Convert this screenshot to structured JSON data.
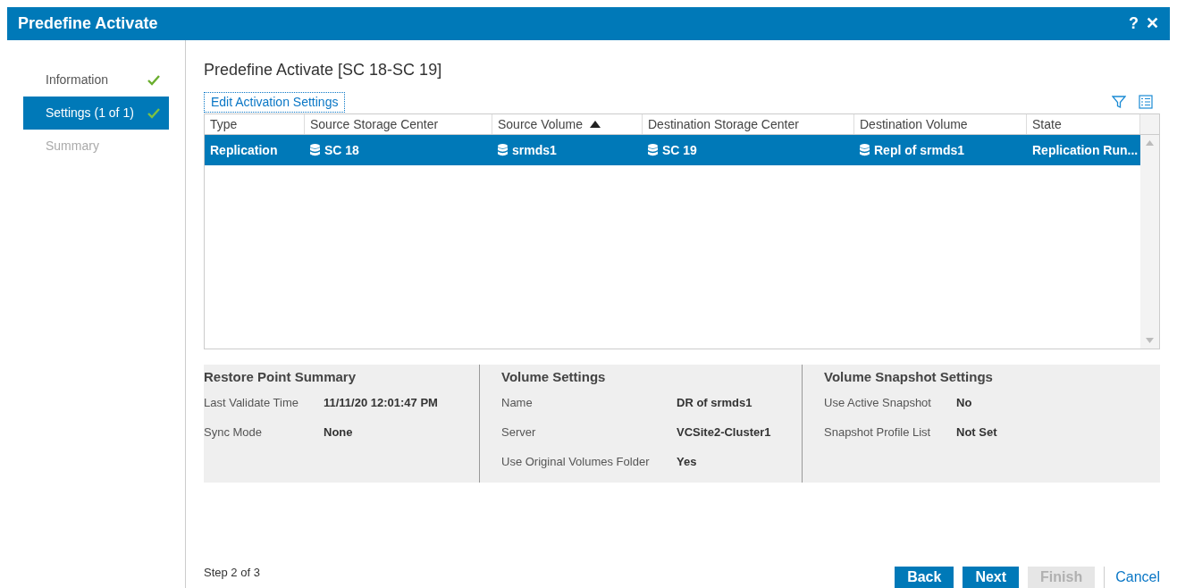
{
  "window": {
    "title": "Predefine Activate",
    "help": "?",
    "close": "✕"
  },
  "steps": [
    {
      "label": "Information",
      "done": true,
      "selected": false,
      "disabled": false
    },
    {
      "label": "Settings (1 of 1)",
      "done": true,
      "selected": true,
      "disabled": false
    },
    {
      "label": "Summary",
      "done": false,
      "selected": false,
      "disabled": true
    }
  ],
  "heading": "Predefine Activate [SC 18-SC 19]",
  "edit_link": "Edit Activation Settings",
  "table": {
    "columns": [
      {
        "label": "Type",
        "sorted": false
      },
      {
        "label": "Source Storage Center",
        "sorted": false
      },
      {
        "label": "Source Volume",
        "sorted": true
      },
      {
        "label": "Destination Storage Center",
        "sorted": false
      },
      {
        "label": "Destination Volume",
        "sorted": false
      },
      {
        "label": "State",
        "sorted": false
      }
    ],
    "rows": [
      {
        "selected": true,
        "cells": [
          {
            "text": "Replication",
            "icon": false
          },
          {
            "text": "SC 18",
            "icon": true
          },
          {
            "text": "srmds1",
            "icon": true
          },
          {
            "text": "SC 19",
            "icon": true
          },
          {
            "text": "Repl of srmds1",
            "icon": true
          },
          {
            "text": "Replication Run...",
            "icon": false
          }
        ]
      }
    ]
  },
  "sections": [
    {
      "title": "Restore Point Summary",
      "fields": [
        {
          "label": "Last Validate Time",
          "value": "11/11/20 12:01:47 PM"
        },
        {
          "label": "Sync Mode",
          "value": "None"
        }
      ]
    },
    {
      "title": "Volume Settings",
      "fields": [
        {
          "label": "Name",
          "value": "DR of srmds1"
        },
        {
          "label": "Server",
          "value": "VCSite2-Cluster1"
        },
        {
          "label": "Use Original Volumes Folder",
          "value": "Yes"
        }
      ]
    },
    {
      "title": "Volume Snapshot Settings",
      "fields": [
        {
          "label": "Use Active Snapshot",
          "value": "No"
        },
        {
          "label": "Snapshot Profile List",
          "value": "Not Set"
        }
      ]
    }
  ],
  "step_text": "Step 2 of 3",
  "buttons": [
    {
      "label": "Back",
      "kind": "primary",
      "disabled": false
    },
    {
      "label": "Next",
      "kind": "primary",
      "disabled": false
    },
    {
      "label": "Finish",
      "kind": "primary",
      "disabled": true
    },
    {
      "label": "Cancel",
      "kind": "link",
      "disabled": false
    }
  ]
}
